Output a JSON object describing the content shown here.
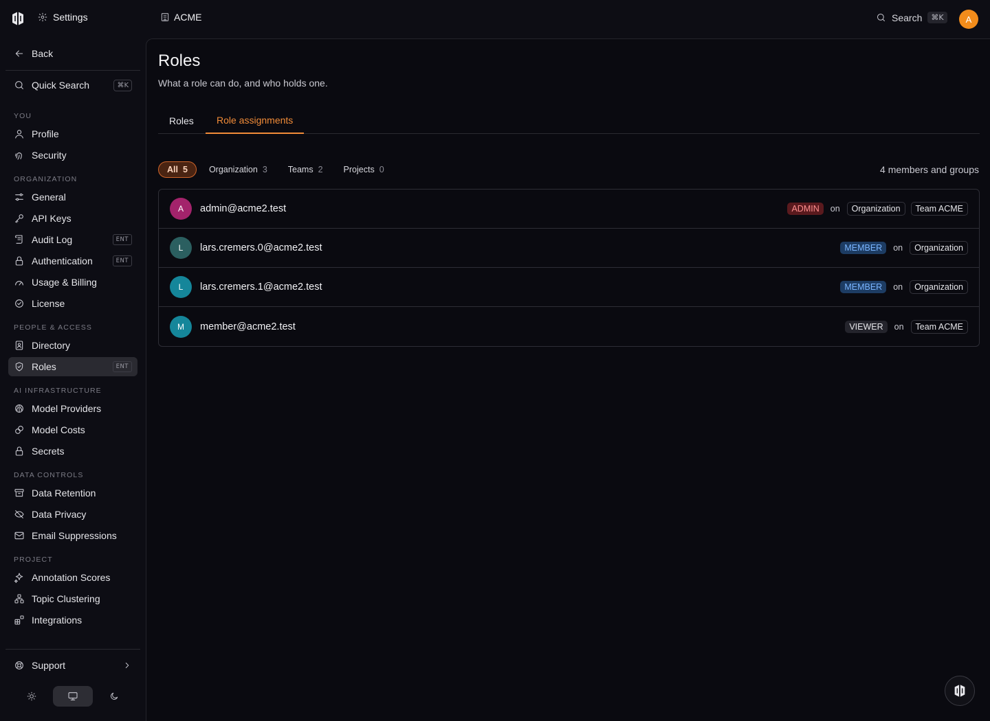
{
  "topbar": {
    "settings_label": "Settings",
    "org_label": "ACME",
    "search_label": "Search",
    "search_shortcut": "⌘K",
    "avatar_initial": "A"
  },
  "sidebar": {
    "back_label": "Back",
    "quick_search": {
      "label": "Quick Search",
      "shortcut": "⌘K"
    },
    "sections": {
      "you": "YOU",
      "organization": "ORGANIZATION",
      "people": "PEOPLE & ACCESS",
      "ai": "AI INFRASTRUCTURE",
      "data": "DATA CONTROLS",
      "project": "PROJECT"
    },
    "items": {
      "profile": "Profile",
      "security": "Security",
      "general": "General",
      "api_keys": "API Keys",
      "audit_log": "Audit Log",
      "authentication": "Authentication",
      "usage_billing": "Usage & Billing",
      "license": "License",
      "directory": "Directory",
      "roles": "Roles",
      "model_providers": "Model Providers",
      "model_costs": "Model Costs",
      "secrets": "Secrets",
      "data_retention": "Data Retention",
      "data_privacy": "Data Privacy",
      "email_suppressions": "Email Suppressions",
      "annotation_scores": "Annotation Scores",
      "topic_clustering": "Topic Clustering",
      "integrations": "Integrations"
    },
    "ent_badge": "ENT",
    "support_label": "Support",
    "theme_active": "system"
  },
  "page": {
    "title": "Roles",
    "subtitle": "What a role can do, and who holds one.",
    "tabs": {
      "roles": "Roles",
      "assignments": "Role assignments"
    },
    "active_tab": "Role assignments",
    "filters": [
      {
        "label": "All",
        "count": "5"
      },
      {
        "label": "Organization",
        "count": "3"
      },
      {
        "label": "Teams",
        "count": "2"
      },
      {
        "label": "Projects",
        "count": "0"
      }
    ],
    "members_count": "4 members and groups",
    "on_label": "on",
    "assignments": [
      {
        "initial": "A",
        "email": "admin@acme2.test",
        "color": "#a3236b",
        "role": "ADMIN",
        "scopes": [
          "Organization",
          "Team ACME"
        ]
      },
      {
        "initial": "L",
        "email": "lars.cremers.0@acme2.test",
        "color": "#2b5f60",
        "role": "MEMBER",
        "scopes": [
          "Organization"
        ]
      },
      {
        "initial": "L",
        "email": "lars.cremers.1@acme2.test",
        "color": "#15869a",
        "role": "MEMBER",
        "scopes": [
          "Organization"
        ]
      },
      {
        "initial": "M",
        "email": "member@acme2.test",
        "color": "#15869a",
        "role": "VIEWER",
        "scopes": [
          "Team ACME"
        ]
      }
    ]
  },
  "colors": {
    "accent": "#f28c38",
    "admin_badge": "#ff8f8f",
    "member_badge": "#79b4ff"
  }
}
